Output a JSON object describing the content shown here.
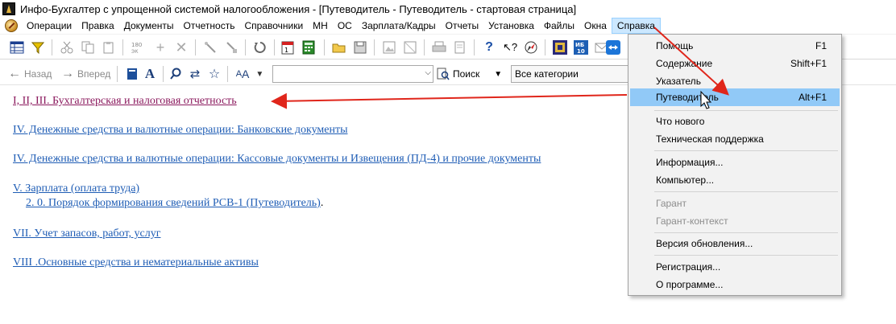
{
  "window": {
    "title": "Инфо-Бухгалтер с упрощенной системой налогообложения - [Путеводитель - Путеводитель - стартовая страница]"
  },
  "menubar": {
    "items": [
      "Операции",
      "Правка",
      "Документы",
      "Отчетность",
      "Справочники",
      "МН",
      "ОС",
      "Зарплата/Кадры",
      "Отчеты",
      "Установка",
      "Файлы",
      "Окна",
      "Справка"
    ],
    "active": "Справка"
  },
  "toolbar": {
    "icons": [
      "table-grid-icon",
      "filter-icon",
      "cut-icon",
      "copy-icon",
      "paste-icon",
      "format-180-icon",
      "add-icon",
      "delete-icon",
      "tools-icon",
      "tools-alt-icon",
      "refresh-icon",
      "calendar-icon",
      "calculator-icon",
      "open-folder-icon",
      "save-icon",
      "image-icon",
      "image-alt-icon",
      "print-icon",
      "print-preview-icon",
      "help-icon",
      "context-help-icon",
      "compass-icon",
      "chess-icon",
      "ib10-icon",
      "mail-icon",
      "teamviewer-icon",
      "stop-icon"
    ]
  },
  "navbar": {
    "back_label": "Назад",
    "forward_label": "Вперед",
    "search_label": "Поиск",
    "category_value": "Все категории",
    "search_value": ""
  },
  "content": {
    "links": [
      {
        "text": "I, II, III. Бухгалтерская и налоговая отчетность",
        "visited": true
      },
      {
        "text": "IV. Денежные средства и валютные операции: Банковские документы",
        "visited": false
      },
      {
        "text": "IV. Денежные средства и валютные операции: Кассовые документы и Извещения (ПД-4) и прочие документы",
        "visited": false
      },
      {
        "text": "V. Зарплата (оплата труда)",
        "visited": false
      },
      {
        "text": "VII. Учет запасов, работ, услуг",
        "visited": false
      },
      {
        "text": "VIII .Основные средства и нематериальные активы",
        "visited": false
      }
    ],
    "sublink": {
      "text": "2. 0. Порядок формирования сведений РСВ-1 (Путеводитель)",
      "suffix": "."
    }
  },
  "help_menu": {
    "items": [
      {
        "label": "Помощь",
        "shortcut": "F1",
        "disabled": false
      },
      {
        "label": "Содержание",
        "shortcut": "Shift+F1",
        "disabled": false
      },
      {
        "label": "Указатель",
        "shortcut": "",
        "disabled": false
      },
      {
        "label": "Путеводитель",
        "shortcut": "Alt+F1",
        "disabled": false,
        "highlighted": true
      },
      {
        "label": "Что нового",
        "shortcut": "",
        "disabled": false
      },
      {
        "label": "Техническая поддержка",
        "shortcut": "",
        "disabled": false
      },
      {
        "label": "Информация...",
        "shortcut": "",
        "disabled": false
      },
      {
        "label": "Компьютер...",
        "shortcut": "",
        "disabled": false
      },
      {
        "label": "Гарант",
        "shortcut": "",
        "disabled": true
      },
      {
        "label": "Гарант-контекст",
        "shortcut": "",
        "disabled": true
      },
      {
        "label": "Версия обновления...",
        "shortcut": "",
        "disabled": false
      },
      {
        "label": "Регистрация...",
        "shortcut": "",
        "disabled": false
      },
      {
        "label": "О программе...",
        "shortcut": "",
        "disabled": false
      }
    ]
  },
  "colors": {
    "link": "#1f5db5",
    "visited_link": "#8b1a5e",
    "menu_highlight": "#91c9f7",
    "annotation_arrow": "#e0261b"
  }
}
